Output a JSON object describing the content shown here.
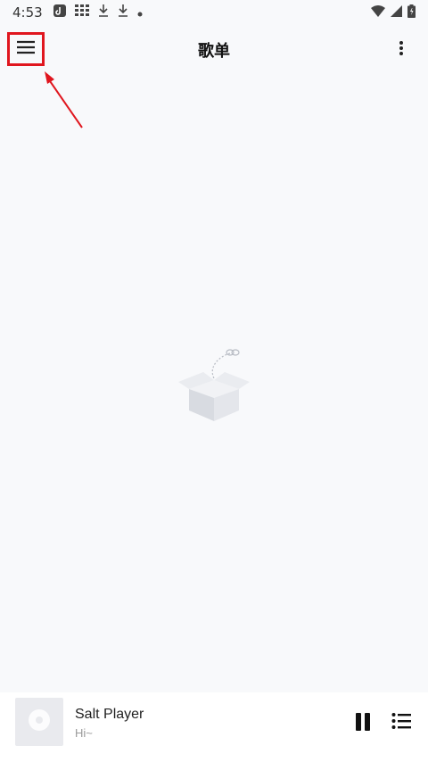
{
  "status_bar": {
    "time": "4:53",
    "left_icons": [
      "app-notification-icon",
      "grid-icon",
      "download-icon",
      "download-icon",
      "dot-icon"
    ],
    "right_icons": [
      "wifi-icon",
      "signal-icon",
      "battery-icon"
    ]
  },
  "app_bar": {
    "title": "歌单",
    "menu_icon": "menu-icon",
    "overflow_icon": "more-vert-icon"
  },
  "annotation": {
    "highlight_color": "#e0161e",
    "arrow_color": "#e0161e"
  },
  "empty_state": {
    "icon": "empty-box-icon"
  },
  "mini_player": {
    "title": "Salt Player",
    "subtitle": "Hi~",
    "play_state_icon": "pause-icon",
    "queue_icon": "queue-list-icon",
    "album_icon": "disc-icon"
  }
}
